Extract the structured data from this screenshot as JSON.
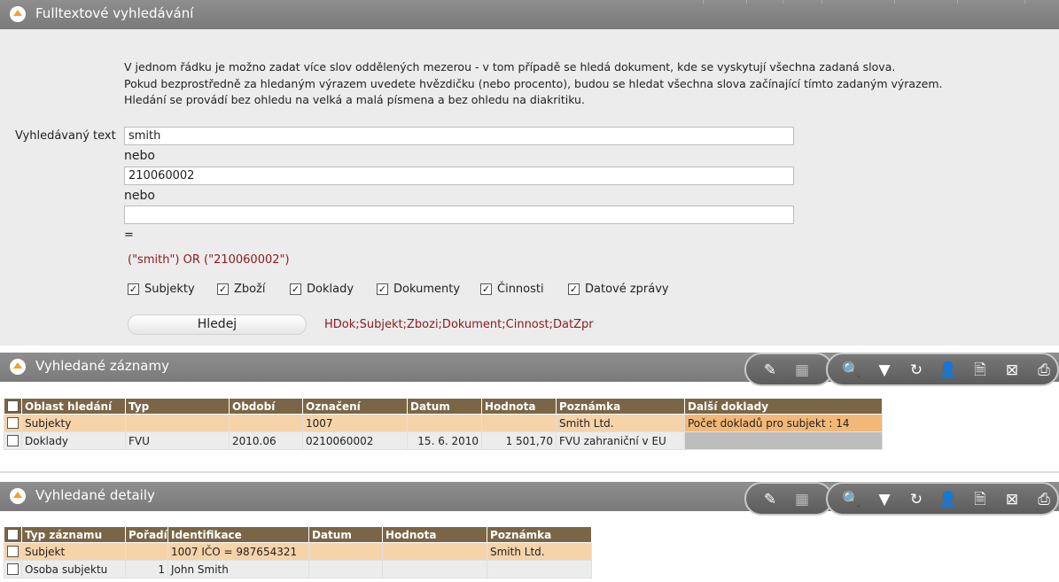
{
  "search_panel": {
    "title": "Fulltextové vyhledávání",
    "hints": [
      "V jednom řádku je možno zadat více slov oddělených mezerou - v tom případě se hledá dokument, kde se vyskytují všechna zadaná slova.",
      "Pokud bezprostředně za hledaným výrazem uvedete hvězdičku (nebo procento), budou se hledat všechna slova začínající tímto zadaným výrazem.",
      "Hledání se provádí bez ohledu na velká a malá písmena a bez ohledu na diakritiku."
    ],
    "field_label": "Vyhledávaný text",
    "input1": "smith",
    "or1": "nebo",
    "input2": "210060002",
    "or2": "nebo",
    "input3": "",
    "equals": "=",
    "expression": "(\"smith\") OR (\"210060002\")",
    "checkboxes": [
      {
        "label": "Subjekty",
        "checked": true
      },
      {
        "label": "Zboží",
        "checked": true
      },
      {
        "label": "Doklady",
        "checked": true
      },
      {
        "label": "Dokumenty",
        "checked": true
      },
      {
        "label": "Činnosti",
        "checked": true
      },
      {
        "label": "Datové zprávy",
        "checked": true
      }
    ],
    "search_button": "Hledej",
    "filter_text": "HDok;Subjekt;Zbozi;Dokument;Cinnost;DatZpr"
  },
  "results_panel": {
    "title": "Vyhledané záznamy",
    "columns": [
      "Oblast hledání",
      "Typ",
      "Období",
      "Označení",
      "Datum",
      "Hodnota",
      "Poznámka",
      "Další doklady"
    ],
    "rows": [
      [
        "Subjekty",
        "",
        "",
        "1007",
        "",
        "",
        "Smith Ltd.",
        "Počet dokladů pro subjekt : 14"
      ],
      [
        "Doklady",
        "FVU",
        "2010.06",
        "0210060002",
        "15. 6. 2010",
        "1 501,70",
        "FVU zahraniční v EU",
        ""
      ]
    ]
  },
  "details_panel": {
    "title": "Vyhledané detaily",
    "columns": [
      "Typ záznamu",
      "Pořadí",
      "Identifikace",
      "Datum",
      "Hodnota",
      "Poznámka"
    ],
    "rows": [
      [
        "Subjekt",
        "",
        "1007  IČO = 987654321",
        "",
        "",
        "Smith Ltd."
      ],
      [
        "Osoba subjektu",
        "1",
        "John Smith",
        "",
        "",
        ""
      ]
    ]
  },
  "toolbar_icons": [
    "edit-icon",
    "grid-icon",
    "search-icon",
    "filter-icon",
    "refresh-icon",
    "users-settings-icon",
    "document-icon",
    "excel-icon",
    "print-icon"
  ]
}
